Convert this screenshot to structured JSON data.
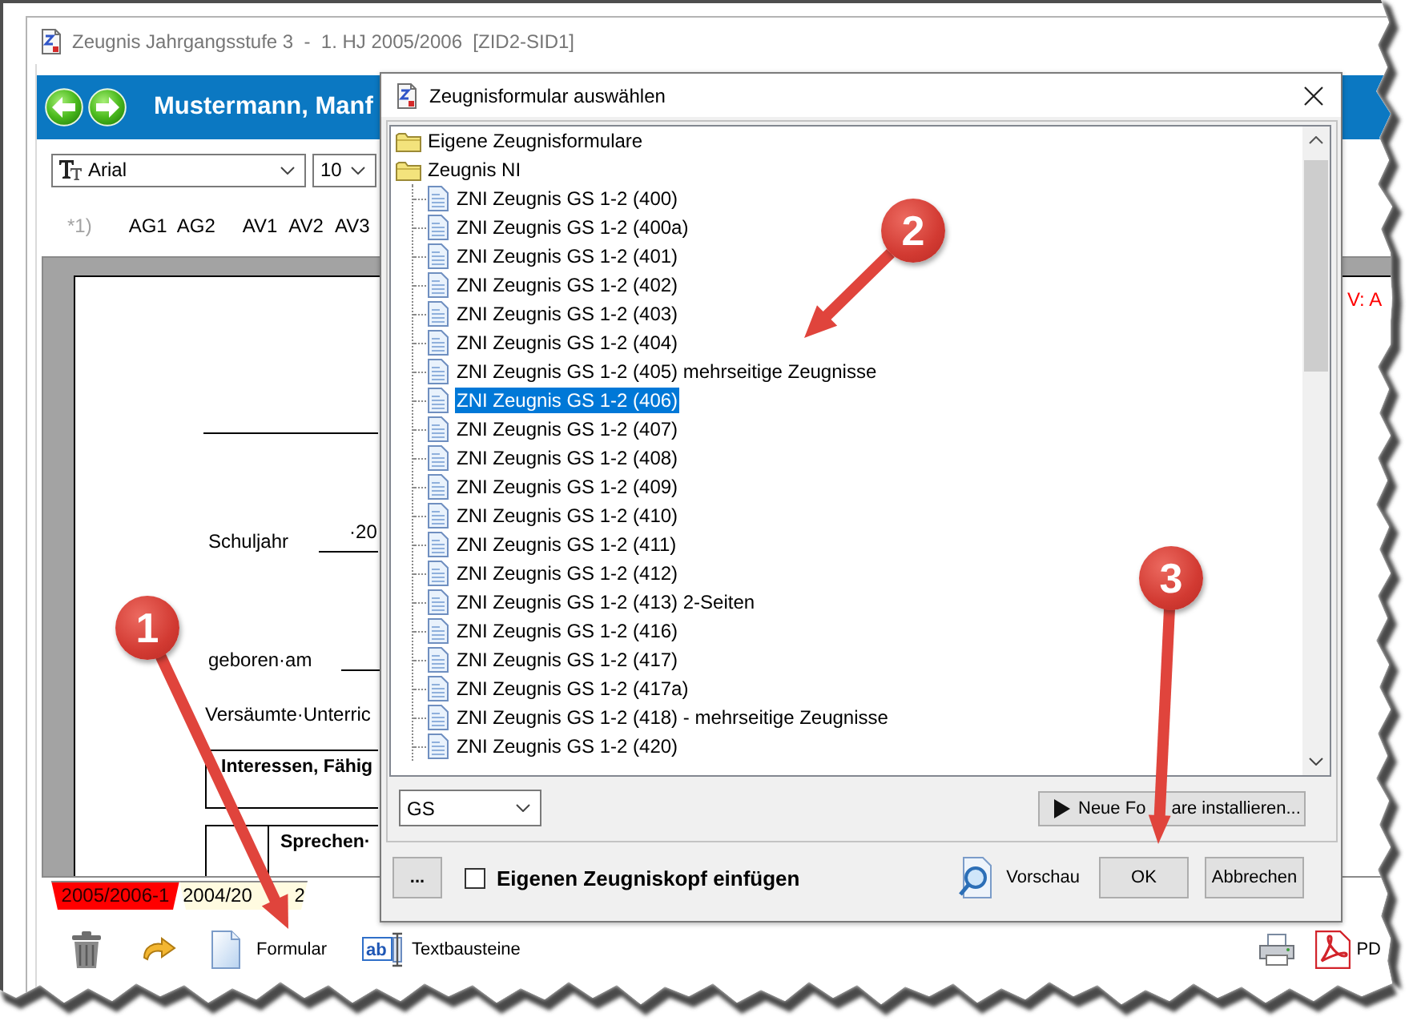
{
  "window": {
    "title": "Zeugnis Jahrgangsstufe 3  -  1. HJ 2005/2006  [ZID2-SID1]"
  },
  "header": {
    "student": "Mustermann, Manf"
  },
  "format_bar": {
    "font": "Arial",
    "size": "10"
  },
  "field_buttons": [
    {
      "label": "*1)",
      "disabled": true
    },
    {
      "label": "AG1",
      "disabled": false
    },
    {
      "label": "AG2",
      "disabled": false
    },
    {
      "label": "AV1",
      "disabled": false
    },
    {
      "label": "AV2",
      "disabled": false
    },
    {
      "label": "AV3",
      "disabled": false
    }
  ],
  "document": {
    "note": "V: A",
    "school_year": {
      "label": "Schuljahr",
      "value": "·20"
    },
    "birth_date": {
      "label": "geboren·am"
    },
    "absence": "Versäumte·Unterric",
    "sections": [
      {
        "kind": "heading",
        "text": "Interessen, Fähig"
      },
      {
        "kind": "split",
        "text": "Sprechen·"
      }
    ]
  },
  "year_tabs": [
    {
      "label_parts": [
        "2005/2006-1"
      ],
      "selected": true
    },
    {
      "label_parts": [
        "2004/20",
        "2"
      ],
      "selected": false
    }
  ],
  "bottom_toolbar": {
    "form_button": "Formular",
    "text_blocks_icon": "ab",
    "text_blocks_button": "Textbausteine",
    "pdf_button": "PD"
  },
  "dialog": {
    "title": "Zeugnisformular auswählen",
    "tree": [
      {
        "label": "Eigene Zeugnisformulare",
        "kind": "folder",
        "selected": false
      },
      {
        "label": "Zeugnis NI",
        "kind": "folder",
        "selected": false,
        "children": [
          {
            "label": "ZNI Zeugnis GS 1-2 (400)",
            "kind": "form",
            "selected": false
          },
          {
            "label": "ZNI Zeugnis GS 1-2 (400a)",
            "kind": "form",
            "selected": false
          },
          {
            "label": "ZNI Zeugnis GS 1-2 (401)",
            "kind": "form",
            "selected": false
          },
          {
            "label": "ZNI Zeugnis GS 1-2 (402)",
            "kind": "form",
            "selected": false
          },
          {
            "label": "ZNI Zeugnis GS 1-2 (403)",
            "kind": "form",
            "selected": false
          },
          {
            "label": "ZNI Zeugnis GS 1-2 (404)",
            "kind": "form",
            "selected": false
          },
          {
            "label": "ZNI Zeugnis GS 1-2 (405) mehrseitige Zeugnisse",
            "kind": "form",
            "selected": false
          },
          {
            "label": "ZNI Zeugnis GS 1-2 (406)",
            "kind": "form",
            "selected": true
          },
          {
            "label": "ZNI Zeugnis GS 1-2 (407)",
            "kind": "form",
            "selected": false
          },
          {
            "label": "ZNI Zeugnis GS 1-2 (408)",
            "kind": "form",
            "selected": false
          },
          {
            "label": "ZNI Zeugnis GS 1-2 (409)",
            "kind": "form",
            "selected": false
          },
          {
            "label": "ZNI Zeugnis GS 1-2 (410)",
            "kind": "form",
            "selected": false
          },
          {
            "label": "ZNI Zeugnis GS 1-2 (411)",
            "kind": "form",
            "selected": false
          },
          {
            "label": "ZNI Zeugnis GS 1-2 (412)",
            "kind": "form",
            "selected": false
          },
          {
            "label": "ZNI Zeugnis GS 1-2 (413) 2-Seiten",
            "kind": "form",
            "selected": false
          },
          {
            "label": "ZNI Zeugnis GS 1-2 (416)",
            "kind": "form",
            "selected": false
          },
          {
            "label": "ZNI Zeugnis GS 1-2 (417)",
            "kind": "form",
            "selected": false
          },
          {
            "label": "ZNI Zeugnis GS 1-2 (417a)",
            "kind": "form",
            "selected": false
          },
          {
            "label": "ZNI Zeugnis GS 1-2 (418) - mehrseitige Zeugnisse",
            "kind": "form",
            "selected": false
          },
          {
            "label": "ZNI Zeugnis GS 1-2 (420)",
            "kind": "form",
            "selected": false
          }
        ]
      }
    ],
    "type_filter": {
      "value": "GS"
    },
    "install_button": {
      "label_parts": [
        "Neue Fo",
        "are installieren..."
      ]
    },
    "more_button": "...",
    "own_header": {
      "label": "Eigenen Zeugniskopf einfügen",
      "checked": false
    },
    "preview_button": "Vorschau",
    "ok_button": "OK",
    "cancel_button": "Abbrechen"
  },
  "callouts": [
    {
      "number": "1"
    },
    {
      "number": "2"
    },
    {
      "number": "3"
    }
  ]
}
